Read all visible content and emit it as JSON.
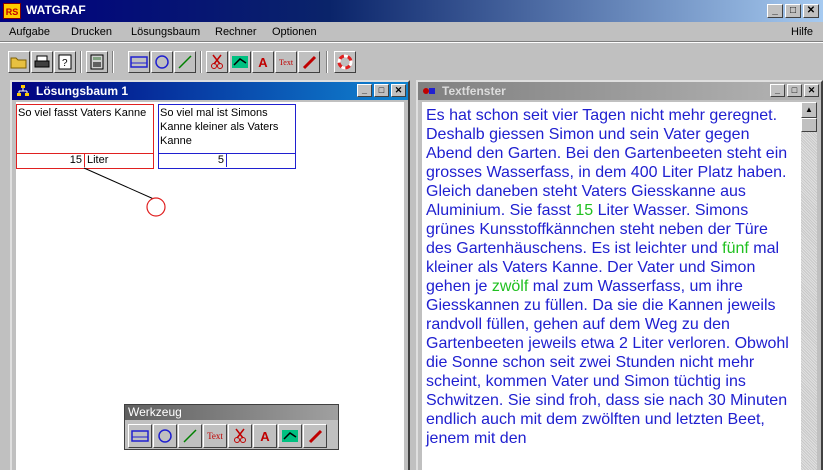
{
  "app": {
    "title": "WATGRAF",
    "logo": "RS"
  },
  "window_buttons": {
    "minimize": "_",
    "restore": "□",
    "close": "✕"
  },
  "menu": {
    "items": [
      "Aufgabe",
      "Drucken",
      "Lösungsbaum",
      "Rechner",
      "Optionen"
    ],
    "help": "Hilfe"
  },
  "toolbar": {
    "buttons": [
      "open-folder-icon",
      "print-icon",
      "help-icon",
      "calculator-icon",
      "box-icon",
      "circle-icon",
      "line-icon",
      "scissors-icon",
      "link-icon",
      "text-a-icon",
      "text-tool-icon",
      "pencil-icon",
      "lifebuoy-icon"
    ],
    "text_a": "A",
    "text_tool": "Text"
  },
  "tree_window": {
    "title": "Lösungsbaum 1",
    "box1": {
      "text": "So viel fasst Vaters Kanne",
      "value": "15",
      "unit": "Liter",
      "color": "#e02020"
    },
    "box2": {
      "text": "So viel mal ist Simons Kanne kleiner als Vaters Kanne",
      "value": "5",
      "unit": "",
      "color": "#2020d0"
    }
  },
  "text_window": {
    "title": "Textfenster",
    "segments": [
      {
        "t": "Es hat schon seit vier Tagen nicht mehr geregnet. Deshalb giessen Simon und sein Vater gegen Abend den Garten. Bei den Gartenbeeten steht ein grosses Wasserfass, in dem 400 Liter Platz haben. Gleich daneben steht Vaters Giesskanne aus Aluminium. Sie fasst ",
        "hl": false
      },
      {
        "t": "15",
        "hl": true
      },
      {
        "t": " Liter Wasser. Simons grünes Kunsstoffkännchen steht neben der Türe des Gartenhäuschens. Es ist leichter und ",
        "hl": false
      },
      {
        "t": "fünf",
        "hl": true
      },
      {
        "t": " mal kleiner als Vaters Kanne. Der Vater und Simon gehen je ",
        "hl": false
      },
      {
        "t": "zwölf",
        "hl": true
      },
      {
        "t": " mal zum Wasserfass, um ihre Giesskannen zu füllen. Da sie die Kannen jeweils randvoll füllen, gehen auf dem Weg zu den Gartenbeeten jeweils etwa 2 Liter verloren. Obwohl die Sonne schon seit zwei Stunden nicht mehr scheint, kommen Vater und Simon tüchtig ins Schwitzen. Sie sind froh, dass sie nach 30 Minuten endlich auch mit dem zwölften und letzten Beet, jenem mit den",
        "hl": false
      }
    ],
    "highlight_color": "#20c020",
    "text_color": "#2020d0"
  },
  "werkzeug": {
    "title": "Werkzeug",
    "tools": [
      "box-icon",
      "circle-icon",
      "line-icon",
      "text-tool-icon",
      "scissors-icon",
      "text-a-icon",
      "link-icon",
      "pencil-icon"
    ],
    "text_tool": "Text",
    "text_a": "A"
  }
}
